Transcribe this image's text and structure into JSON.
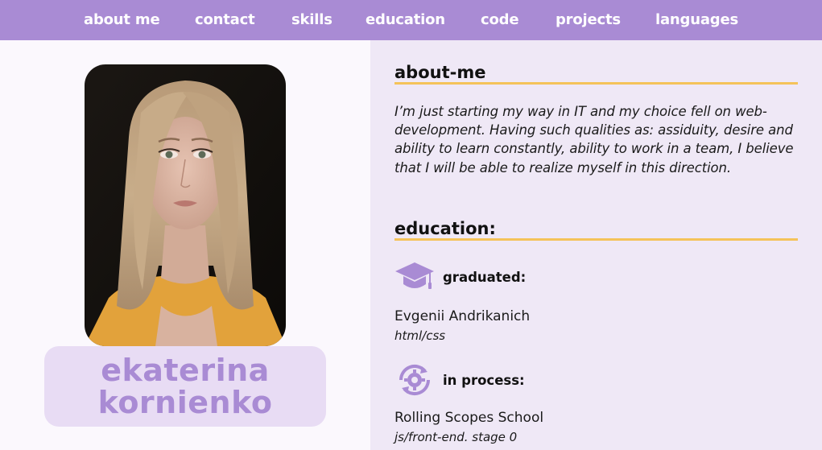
{
  "nav": {
    "items": [
      "about me",
      "contact",
      "skills",
      "education",
      "code",
      "projects",
      "languages"
    ]
  },
  "profile": {
    "first_name": "ekaterina",
    "last_name": "kornienko",
    "photo": "profile-photo"
  },
  "about": {
    "title": "about-me",
    "text": "I’m just starting my way in IT and my choice fell on web-development. Having such qualities as: assiduity, desire and ability to learn constantly, ability to work in a team, I believe that I will be able to realize myself in this direction."
  },
  "education": {
    "title": "education:",
    "entries": [
      {
        "icon": "graduation-cap-icon",
        "label": "graduated:",
        "org": "Evgenii Andrikanich",
        "course": "html/css"
      },
      {
        "icon": "gear-refresh-icon",
        "label": "in process:",
        "org": "Rolling Scopes School",
        "course": "js/front-end. stage 0"
      }
    ]
  },
  "colors": {
    "accent": "#a98bd4",
    "underline": "#f5c35a",
    "right_bg": "#efe8f6",
    "name_card_bg": "#e8dcf4"
  }
}
